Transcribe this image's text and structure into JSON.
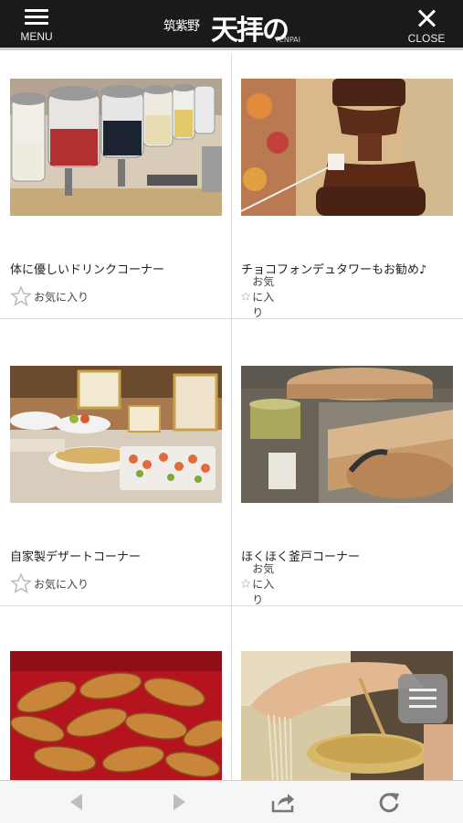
{
  "header": {
    "menu_label": "MENU",
    "close_label": "CLOSE",
    "logo_small": "筑紫野",
    "logo_main": "天拝の郷",
    "logo_tag": "TENPAI"
  },
  "cards": [
    {
      "title": "体に優しいドリンクコーナー",
      "fav_label": "お気に入り",
      "photo": "drink-dispensers"
    },
    {
      "title": "チョコフォンデュタワーもお勧め♪",
      "fav_label": "お気に入り",
      "photo": "chocolate-fountain"
    },
    {
      "title": "自家製デザートコーナー",
      "fav_label": "お気に入り",
      "photo": "dessert-buffet"
    },
    {
      "title": "ほくほく釜戸コーナー",
      "fav_label": "お気に入り",
      "photo": "rice-cooker-kamado"
    },
    {
      "title": "",
      "fav_label": "",
      "photo": "croissants"
    },
    {
      "title": "",
      "fav_label": "",
      "photo": "soba-noodles"
    }
  ],
  "icons": {
    "back": "back-arrow-icon",
    "forward": "forward-arrow-icon",
    "share": "share-icon",
    "reload": "reload-icon",
    "floating_menu": "floating-menu-icon"
  },
  "colors": {
    "header_bg": "#1a1a1a",
    "bottom_bar_bg": "#f6f6f6"
  }
}
